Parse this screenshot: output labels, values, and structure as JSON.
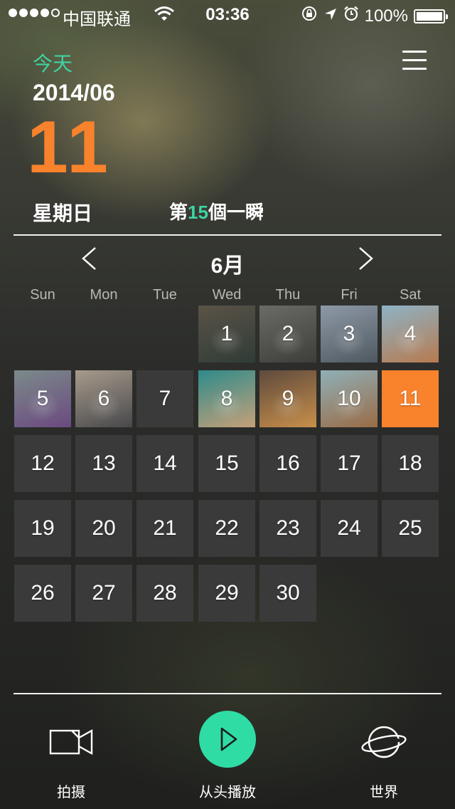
{
  "status_bar": {
    "carrier": "中国联通",
    "time": "03:36",
    "battery_text": "100%",
    "battery_level": 1.0,
    "signal_filled": 4,
    "signal_total": 5
  },
  "header": {
    "today_label": "今天",
    "year_month": "2014/06",
    "day": "11",
    "weekday": "星期日",
    "moments_prefix": "第",
    "moments_count": "15",
    "moments_suffix": "個一瞬"
  },
  "calendar": {
    "month_label": "6月",
    "weekdays": [
      "Sun",
      "Mon",
      "Tue",
      "Wed",
      "Thu",
      "Fri",
      "Sat"
    ],
    "first_weekday_index": 3,
    "days_in_month": 30,
    "selected_day": 11,
    "photo_days": [
      1,
      2,
      3,
      4,
      5,
      6,
      8,
      9,
      10
    ]
  },
  "bottom_bar": {
    "capture_label": "拍摄",
    "replay_label": "从头播放",
    "world_label": "世界"
  },
  "icons": {
    "menu": "menu-icon",
    "prev": "chevron-left-icon",
    "next": "chevron-right-icon",
    "capture": "video-camera-icon",
    "replay": "play-icon",
    "world": "planet-icon"
  },
  "colors": {
    "accent_orange": "#f9822c",
    "accent_green": "#3ed3a2",
    "play_green": "#2fdca4",
    "cell_gray": "#3a3a3a"
  }
}
